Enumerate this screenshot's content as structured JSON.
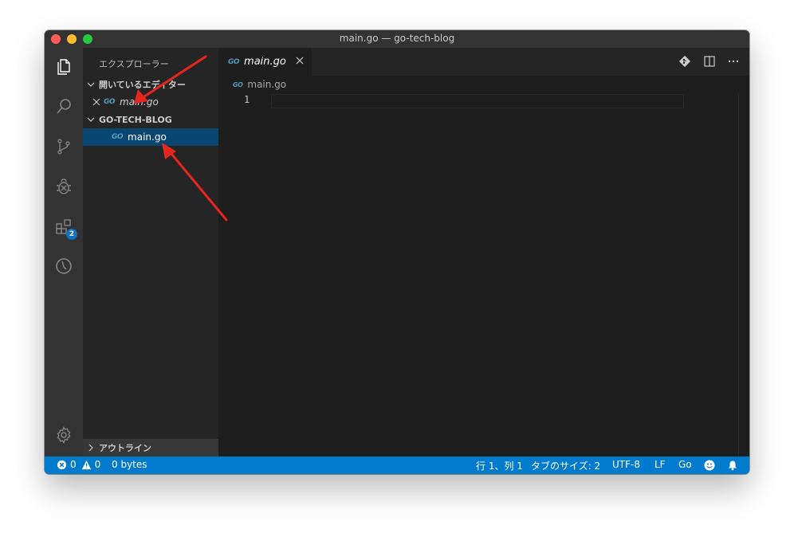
{
  "window": {
    "title": "main.go — go-tech-blog"
  },
  "activity_bar": {
    "extensions_badge": "2"
  },
  "sidebar": {
    "title": "エクスプローラー",
    "open_editors": {
      "label": "開いているエディター",
      "items": [
        {
          "name": "main.go",
          "icon_text": "GO"
        }
      ]
    },
    "folder": {
      "label": "GO-TECH-BLOG",
      "items": [
        {
          "name": "main.go",
          "icon_text": "GO"
        }
      ]
    },
    "outline": {
      "label": "アウトライン"
    }
  },
  "editor": {
    "tab": {
      "label": "main.go",
      "icon_text": "GO"
    },
    "breadcrumb": {
      "label": "main.go",
      "icon_text": "GO"
    },
    "line_numbers": [
      "1"
    ]
  },
  "status_bar": {
    "errors": "0",
    "warnings": "0",
    "file_size": "0 bytes",
    "position": "行 1、列 1",
    "tab_size": "タブのサイズ: 2",
    "encoding": "UTF-8",
    "eol": "LF",
    "language": "Go"
  },
  "colors": {
    "status_bar": "#007acc",
    "selection": "#094771",
    "activity_bar": "#333333",
    "sidebar": "#252526",
    "editor": "#1e1e1e",
    "go_icon": "#519aba",
    "annotation_arrow": "#e5261f"
  }
}
